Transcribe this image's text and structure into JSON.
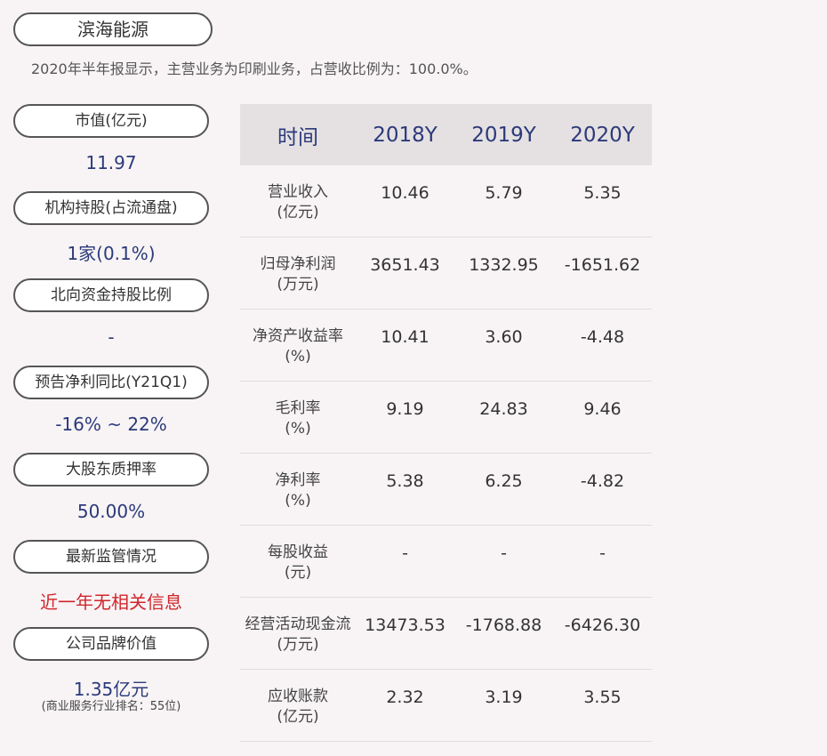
{
  "header": {
    "company": "滨海能源",
    "subtitle": "2020年半年报显示，主营业务为印刷业务，占营收比例为：100.0%。"
  },
  "metrics": [
    {
      "label": "市值(亿元)",
      "value": "11.97"
    },
    {
      "label": "机构持股(占流通盘)",
      "value": "1家(0.1%)"
    },
    {
      "label": "北向资金持股比例",
      "value": "-"
    },
    {
      "label": "预告净利同比(Y21Q1)",
      "value": "-16% ~ 22%"
    },
    {
      "label": "大股东质押率",
      "value": "50.00%"
    },
    {
      "label": "最新监管情况",
      "value": "近一年无相关信息"
    },
    {
      "label": "公司品牌价值",
      "value": "1.35亿元",
      "note": "(商业服务行业排名：55位)"
    }
  ],
  "table": {
    "headers": [
      "时间",
      "2018Y",
      "2019Y",
      "2020Y"
    ],
    "rows": [
      {
        "label": [
          "营业收入",
          "(亿元)"
        ],
        "values": [
          "10.46",
          "5.79",
          "5.35"
        ]
      },
      {
        "label": [
          "归母净利润",
          "(万元)"
        ],
        "values": [
          "3651.43",
          "1332.95",
          "-1651.62"
        ]
      },
      {
        "label": [
          "净资产收益率",
          "(%)"
        ],
        "values": [
          "10.41",
          "3.60",
          "-4.48"
        ]
      },
      {
        "label": [
          "毛利率",
          "(%)"
        ],
        "values": [
          "9.19",
          "24.83",
          "9.46"
        ]
      },
      {
        "label": [
          "净利率",
          "(%)"
        ],
        "values": [
          "5.38",
          "6.25",
          "-4.82"
        ]
      },
      {
        "label": [
          "每股收益",
          "(元)"
        ],
        "values": [
          "-",
          "-",
          "-"
        ]
      },
      {
        "label": [
          "经营活动现金流",
          "(万元)"
        ],
        "values": [
          "13473.53",
          "-1768.88",
          "-6426.30"
        ]
      },
      {
        "label": [
          "应收账款",
          "(亿元)"
        ],
        "values": [
          "2.32",
          "3.19",
          "3.55"
        ]
      }
    ]
  },
  "colors": {
    "accent": "#2b3a7a",
    "alert": "#d0262c",
    "header_bg": "#e5e0e2"
  }
}
